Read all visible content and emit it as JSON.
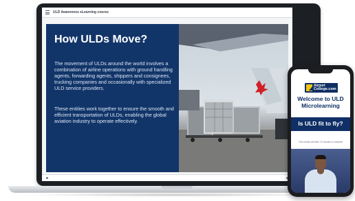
{
  "laptop": {
    "topbar": {
      "course_title": "ULD Awareness eLearning course"
    },
    "slide": {
      "title": "How ULDs Move?",
      "paragraph1": "The movement of ULDs around the world involves a combination of airline operations with ground handling agents, forwarding agents, shippers and consignees, trucking companies and occasionally with specialized ULD service providers.",
      "paragraph2": "These entities work together to ensure the smooth and efficient transportation of ULDs, enabling the global aviation industry to operate effectively."
    }
  },
  "phone": {
    "logo": {
      "line1": "Airport",
      "line2": "College.com"
    },
    "heading": "Welcome to ULD Microlearning",
    "banner": "Is ULD fit to fly?",
    "note": "This module will take 3-5 minutes to complete"
  },
  "colors": {
    "slide_panel": "#123569",
    "phone_banner": "#0f2f66",
    "logo_yellow": "#f3c316"
  }
}
